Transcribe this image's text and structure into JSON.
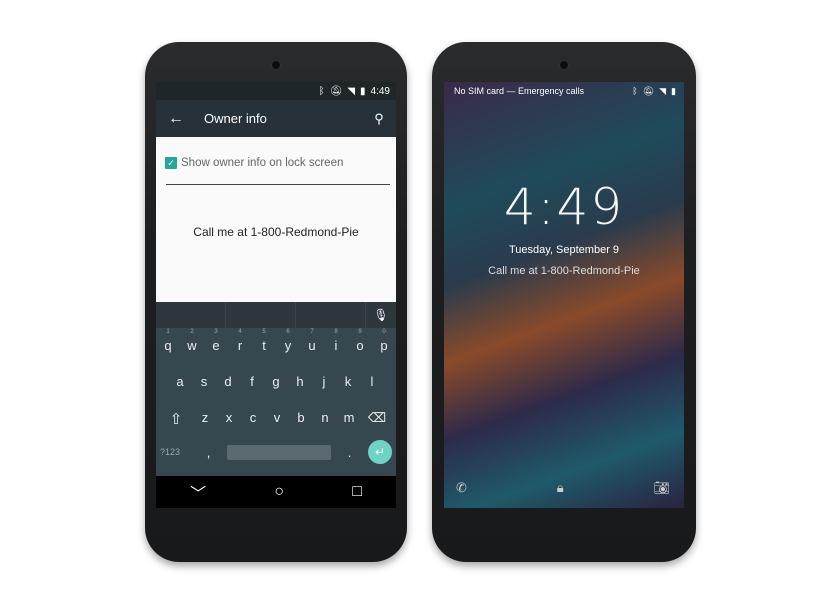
{
  "left_phone": {
    "status": {
      "time": "4:49",
      "icons": [
        "bluetooth-icon",
        "mute-icon",
        "wifi-icon",
        "battery-icon"
      ]
    },
    "toolbar": {
      "title": "Owner info"
    },
    "checkbox_label": "Show owner info on lock screen",
    "checkbox_checked": true,
    "owner_text": "Call me at 1-800-Redmond-Pie",
    "keyboard": {
      "row1": [
        "q",
        "w",
        "e",
        "r",
        "t",
        "y",
        "u",
        "i",
        "o",
        "p"
      ],
      "row1_nums": [
        "1",
        "2",
        "3",
        "4",
        "5",
        "6",
        "7",
        "8",
        "9",
        "0"
      ],
      "row2": [
        "a",
        "s",
        "d",
        "f",
        "g",
        "h",
        "j",
        "k",
        "l"
      ],
      "row3": [
        "z",
        "x",
        "c",
        "v",
        "b",
        "n",
        "m"
      ],
      "symbols": "?123",
      "comma": ",",
      "period": "."
    }
  },
  "right_phone": {
    "status_text": "No SIM card — Emergency calls",
    "clock": "4:49",
    "date": "Tuesday, September 9",
    "owner_text": "Call me at 1-800-Redmond-Pie"
  },
  "colors": {
    "accent": "#26a69a",
    "toolbar": "#263238",
    "keyboard": "#37474f"
  }
}
